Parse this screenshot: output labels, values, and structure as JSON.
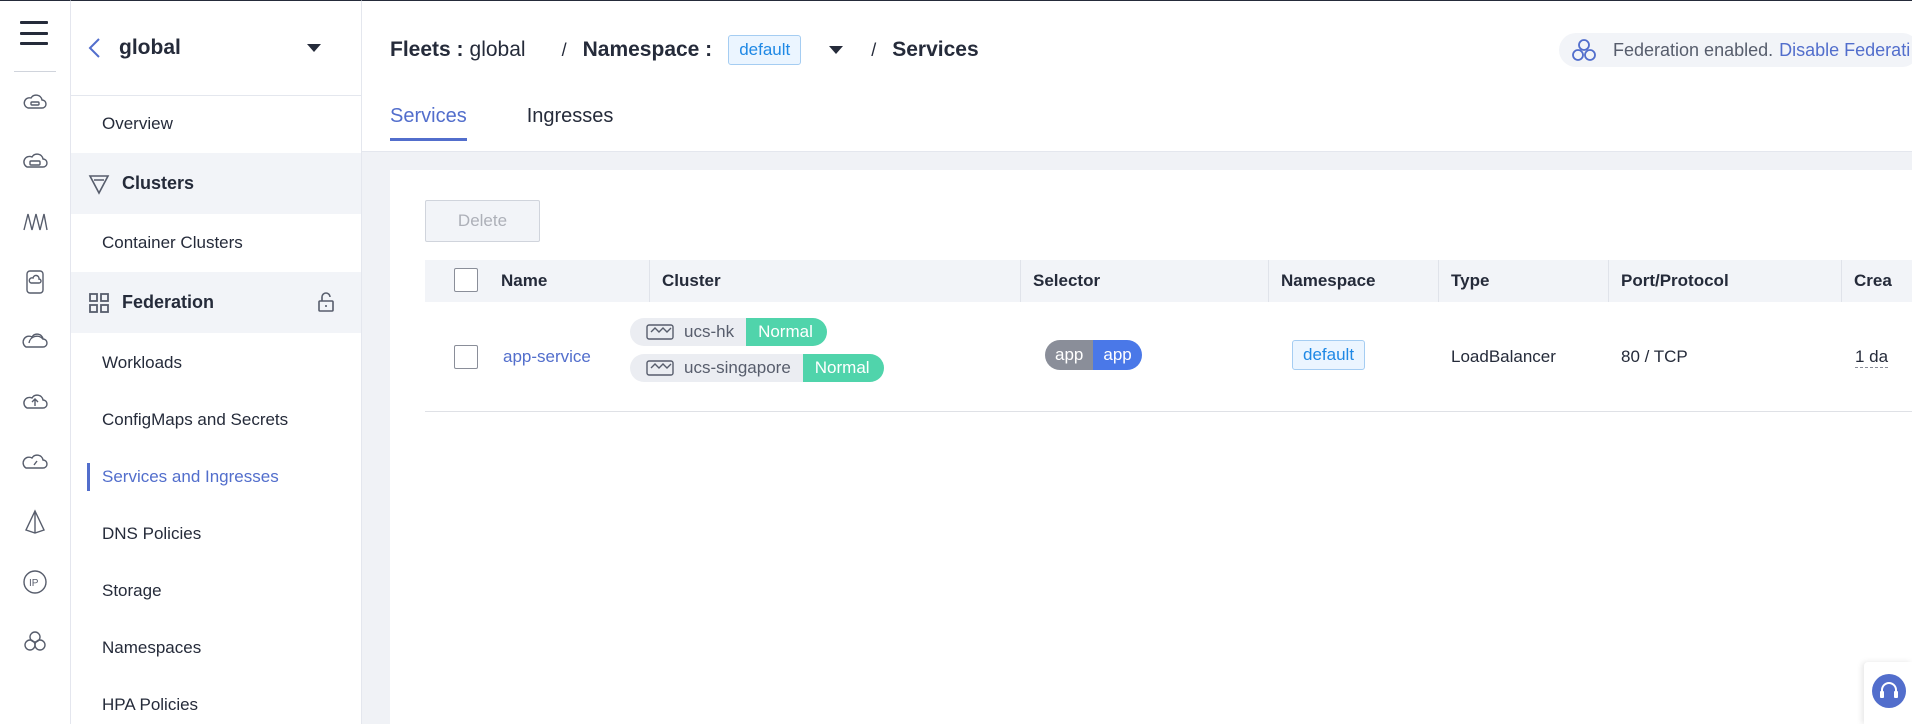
{
  "rail": {
    "icons": [
      "cloud-icon",
      "cloud-chip-icon",
      "cluster-wave-icon",
      "device-icon",
      "cloud-ring-icon",
      "cloud-upload-icon",
      "cloud-gauge-icon",
      "prism-icon",
      "ip-icon",
      "cluster-circles-icon"
    ]
  },
  "sidebar": {
    "title": "global",
    "overview": "Overview",
    "clusters_group": "Clusters",
    "container_clusters": "Container Clusters",
    "federation_group": "Federation",
    "items": [
      "Workloads",
      "ConfigMaps and Secrets",
      "Services and Ingresses",
      "DNS Policies",
      "Storage",
      "Namespaces",
      "HPA Policies"
    ],
    "active_item": "Services and Ingresses"
  },
  "header": {
    "fleets_label": "Fleets :",
    "fleets_value": "global",
    "namespace_label": "Namespace :",
    "namespace_value": "default",
    "page": "Services",
    "federation_status": "Federation enabled.",
    "federation_action": "Disable Federati"
  },
  "tabs": [
    "Services",
    "Ingresses"
  ],
  "toolbar": {
    "delete_label": "Delete"
  },
  "table": {
    "columns": [
      "Name",
      "Cluster",
      "Selector",
      "Namespace",
      "Type",
      "Port/Protocol",
      "Crea"
    ],
    "rows": [
      {
        "name": "app-service",
        "clusters": [
          {
            "name": "ucs-hk",
            "status": "Normal"
          },
          {
            "name": "ucs-singapore",
            "status": "Normal"
          }
        ],
        "selector_key": "app",
        "selector_value": "app",
        "namespace": "default",
        "type": "LoadBalancer",
        "port": "80 / TCP",
        "created": "1 da"
      }
    ]
  },
  "colors": {
    "accent": "#526ecc",
    "normal": "#50d4ab",
    "tag_blue": "#1e88e5"
  }
}
